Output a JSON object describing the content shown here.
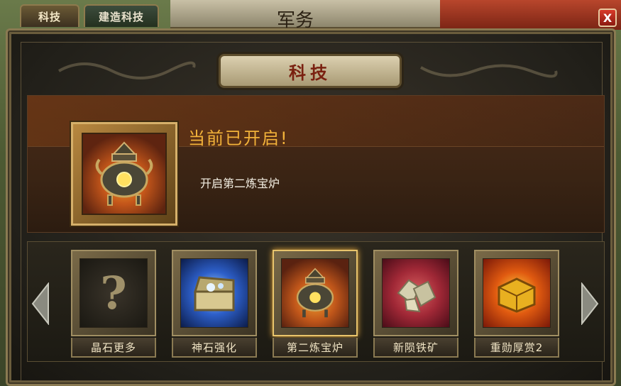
{
  "tabs": [
    {
      "label": "科技",
      "active": true
    },
    {
      "label": "建造科技",
      "active": false
    }
  ],
  "background_banner": "军务",
  "close_label": "X",
  "panel_title": "科技",
  "current_status": {
    "title": "当前已开启!",
    "description": "开启第二炼宝炉"
  },
  "items": [
    {
      "label": "晶石更多",
      "icon": "question-mark-icon",
      "selected": false
    },
    {
      "label": "神石强化",
      "icon": "treasure-chest-icon",
      "selected": false
    },
    {
      "label": "第二炼宝炉",
      "icon": "cauldron-icon",
      "selected": true
    },
    {
      "label": "新陨铁矿",
      "icon": "iron-ore-icon",
      "selected": false
    },
    {
      "label": "重勋厚赏2",
      "icon": "gold-box-icon",
      "selected": false
    }
  ],
  "colors": {
    "title_gold": "#f2b23a",
    "close_red": "#d83a2a",
    "frame_gold": "#d6b06a"
  }
}
